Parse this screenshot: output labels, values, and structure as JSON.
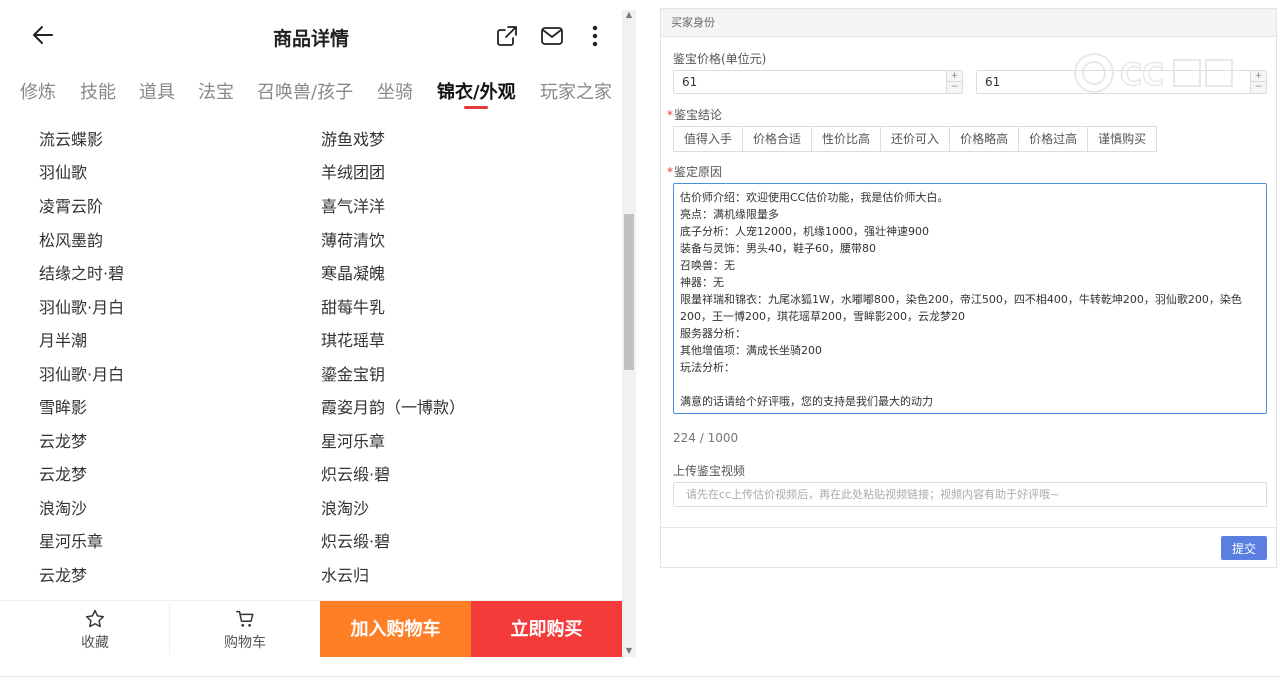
{
  "header": {
    "title": "商品详情"
  },
  "tabs": [
    {
      "label": "修炼",
      "active": false
    },
    {
      "label": "技能",
      "active": false
    },
    {
      "label": "道具",
      "active": false
    },
    {
      "label": "法宝",
      "active": false
    },
    {
      "label": "召唤兽/孩子",
      "active": false
    },
    {
      "label": "坐骑",
      "active": false
    },
    {
      "label": "锦衣/外观",
      "active": true
    },
    {
      "label": "玩家之家",
      "active": false
    }
  ],
  "outfits_left": [
    "流云蝶影",
    "羽仙歌",
    "凌霄云阶",
    "松风墨韵",
    "结缘之时·碧",
    "羽仙歌·月白",
    "月半潮",
    "羽仙歌·月白",
    "雪眸影",
    "云龙梦",
    "云龙梦",
    "浪淘沙",
    "星河乐章",
    "云龙梦"
  ],
  "outfits_right": [
    "游鱼戏梦",
    "羊绒团团",
    "喜气洋洋",
    "薄荷清饮",
    "寒晶凝魄",
    "甜莓牛乳",
    "琪花瑶草",
    "鎏金宝钥",
    "霞姿月韵（一博款）",
    "星河乐章",
    "炽云缎·碧",
    "浪淘沙",
    "炽云缎·碧",
    "水云归"
  ],
  "footer": {
    "favorite_label": "收藏",
    "cart_label": "购物车",
    "add_to_cart_label": "加入购物车",
    "buy_now_label": "立即购买"
  },
  "form": {
    "section_title": "买家身份",
    "price_label": "鉴宝价格(单位元)",
    "price_min": "61",
    "price_max": "61",
    "conclusion_label": "鉴宝结论",
    "conclusion_options": [
      "值得入手",
      "价格合适",
      "性价比高",
      "还价可入",
      "价格略高",
      "价格过高",
      "谨慎购买"
    ],
    "reason_label": "鉴定原因",
    "reason_text": "估价师介绍：欢迎使用CC估价功能，我是估价师大白。\n亮点：满机缘限量多\n底子分析：人宠12000，机缘1000，强壮神速900\n装备与灵饰：男头40，鞋子60，腰带80\n召唤兽：无\n神器：无\n限量祥瑞和锦衣：九尾冰狐1W，水嘟嘟800，染色200，帝江500，四不相400，牛转乾坤200，羽仙歌200，染色200，王一博200，琪花瑶草200，雪眸影200，云龙梦20\n服务器分析：\n其他增值项：满成长坐骑200\n玩法分析：\n\n满意的话请给个好评哦，您的支持是我们最大的动力",
    "char_count": "224 / 1000",
    "video_label": "上传鉴宝视频",
    "video_placeholder": "请先在cc上传估价视频后，再在此处粘贴视频链接；视频内容有助于好评哦~",
    "submit_label": "提交"
  },
  "icons": {
    "back": "arrow-left-icon",
    "share": "share-icon",
    "mail": "mail-icon",
    "more": "more-vertical-icon",
    "favorite": "star-icon",
    "cart": "cart-icon"
  },
  "colors": {
    "accent_red": "#f53a3a",
    "accent_orange": "#ff7f27",
    "submit_blue": "#5b7fe0",
    "focus_blue": "#4a90e2"
  }
}
